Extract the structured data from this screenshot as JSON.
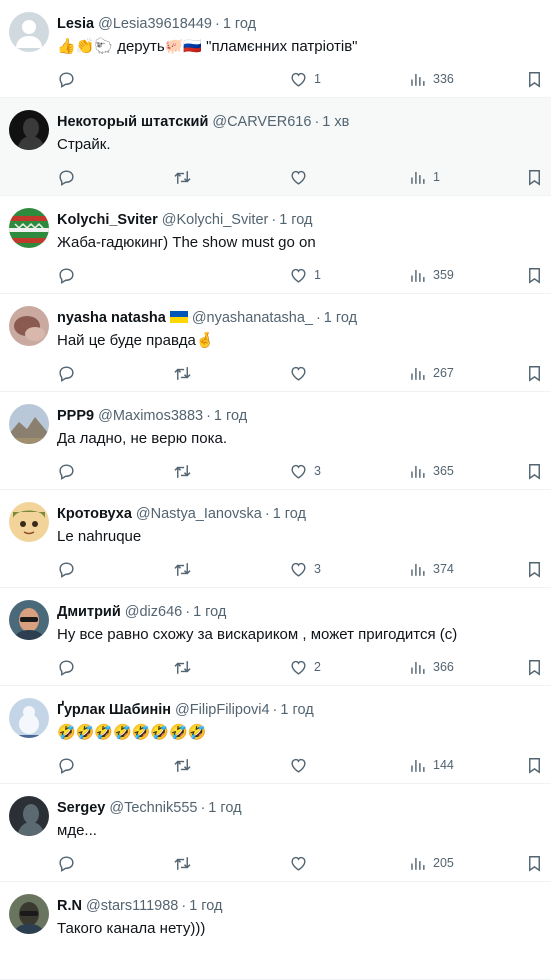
{
  "replies": [
    {
      "name": "Lesia",
      "flag": false,
      "handle": "@Lesia39618449",
      "time": "1 год",
      "text": "👍👏🐑 деруть🐖🇷🇺 \"пламєнних патріотів\"",
      "retweet": false,
      "likes": "1",
      "views": "336",
      "shaded": false,
      "avatar": {
        "bg": "#cfd9de",
        "fg": "#ffffff",
        "kind": "default"
      }
    },
    {
      "name": "Некоторый штатский",
      "flag": false,
      "handle": "@CARVER616",
      "time": "1 хв",
      "text": "Страйк.",
      "retweet": true,
      "likes": "",
      "views": "1",
      "shaded": true,
      "avatar": {
        "bg": "#111111",
        "fg": "#3a3a3a",
        "kind": "dark"
      }
    },
    {
      "name": "Kolychi_Sviter",
      "flag": false,
      "handle": "@Kolychi_Sviter",
      "time": "1 год",
      "text": "Жаба-гадюкинг) The show must go on",
      "retweet": false,
      "likes": "1",
      "views": "359",
      "shaded": false,
      "avatar": {
        "bg": "#2e8b3d",
        "fg": "#c0392b",
        "kind": "sweater"
      }
    },
    {
      "name": "nyasha natasha",
      "flag": true,
      "handle": "@nyashanatasha_",
      "time": "1 год",
      "text": "Най це буде правда🤞",
      "retweet": true,
      "likes": "",
      "views": "267",
      "shaded": false,
      "avatar": {
        "bg": "#c9a9a0",
        "fg": "#8a5a50",
        "kind": "photo"
      }
    },
    {
      "name": "PPP9",
      "flag": false,
      "handle": "@Maximos3883",
      "time": "1 год",
      "text": "Да ладно, не верю пока.",
      "retweet": true,
      "likes": "3",
      "views": "365",
      "shaded": false,
      "avatar": {
        "bg": "#b8c8d8",
        "fg": "#8b8070",
        "kind": "landscape"
      }
    },
    {
      "name": "Кротовуха",
      "flag": false,
      "handle": "@Nastya_Ianovska",
      "time": "1 год",
      "text": "Le nahruque",
      "retweet": true,
      "likes": "3",
      "views": "374",
      "shaded": false,
      "avatar": {
        "bg": "#f2d49a",
        "fg": "#7a8a3a",
        "kind": "cartoon"
      }
    },
    {
      "name": "Дмитрий",
      "flag": false,
      "handle": "@diz646",
      "time": "1 год",
      "text": "Ну все равно схожу за вискариком , может пригодится (с)",
      "retweet": true,
      "likes": "2",
      "views": "366",
      "shaded": false,
      "avatar": {
        "bg": "#4a6a7a",
        "fg": "#d9a080",
        "kind": "face"
      }
    },
    {
      "name": "Ґурлак Шабинін",
      "flag": false,
      "handle": "@FilipFilipovi4",
      "time": "1 год",
      "text": "🤣🤣🤣🤣🤣🤣🤣🤣",
      "retweet": true,
      "likes": "",
      "views": "144",
      "shaded": false,
      "avatar": {
        "bg": "#c5d5e8",
        "fg": "#4a6a9a",
        "kind": "snow"
      }
    },
    {
      "name": "Sergey",
      "flag": false,
      "handle": "@Technik555",
      "time": "1 год",
      "text": "мде...",
      "retweet": true,
      "likes": "",
      "views": "205",
      "shaded": false,
      "avatar": {
        "bg": "#2a3035",
        "fg": "#5a6a70",
        "kind": "dark"
      }
    },
    {
      "name": "R.N",
      "flag": false,
      "handle": "@stars111988",
      "time": "1 год",
      "text": "Такого канала нету)))",
      "retweet": false,
      "likes": "",
      "views": "",
      "shaded": false,
      "avatar": {
        "bg": "#6a7560",
        "fg": "#3a3a30",
        "kind": "face"
      }
    }
  ],
  "colors": {
    "muted": "#536471",
    "text": "#0f1419",
    "divider": "#eff3f4",
    "flag_blue": "#0057b7",
    "flag_yellow": "#ffd700"
  },
  "icons": {
    "reply": "reply-icon",
    "retweet": "retweet-icon",
    "like": "heart-icon",
    "views": "views-icon",
    "bookmark": "bookmark-icon"
  }
}
